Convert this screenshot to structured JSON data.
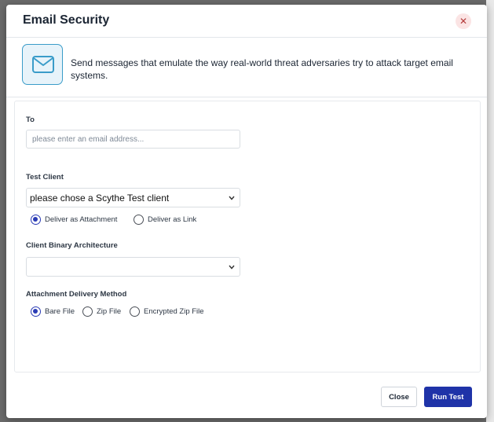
{
  "modal": {
    "title": "Email Security",
    "close_symbol": "✕",
    "intro_text": "Send messages that emulate the way real-world threat adversaries try to attack target email systems.",
    "intro_icon": "envelope-icon"
  },
  "form": {
    "to": {
      "label": "To",
      "value": "",
      "placeholder": "please enter an email address..."
    },
    "test_client": {
      "label": "Test Client",
      "selected": "please chose a Scythe Test client",
      "delivery_options": [
        {
          "label": "Deliver as Attachment",
          "checked": true
        },
        {
          "label": "Deliver as Link",
          "checked": false
        }
      ]
    },
    "binary_arch": {
      "label": "Client Binary Architecture",
      "selected": ""
    },
    "attachment_method": {
      "label": "Attachment Delivery Method",
      "options": [
        {
          "label": "Bare File",
          "checked": true
        },
        {
          "label": "Zip File",
          "checked": false
        },
        {
          "label": "Encrypted Zip File",
          "checked": false
        }
      ]
    }
  },
  "footer": {
    "close_label": "Close",
    "run_label": "Run Test"
  },
  "colors": {
    "accent": "#1f33a8",
    "icon_border": "#3a9cc9",
    "danger_soft": "#fbe4e4"
  }
}
